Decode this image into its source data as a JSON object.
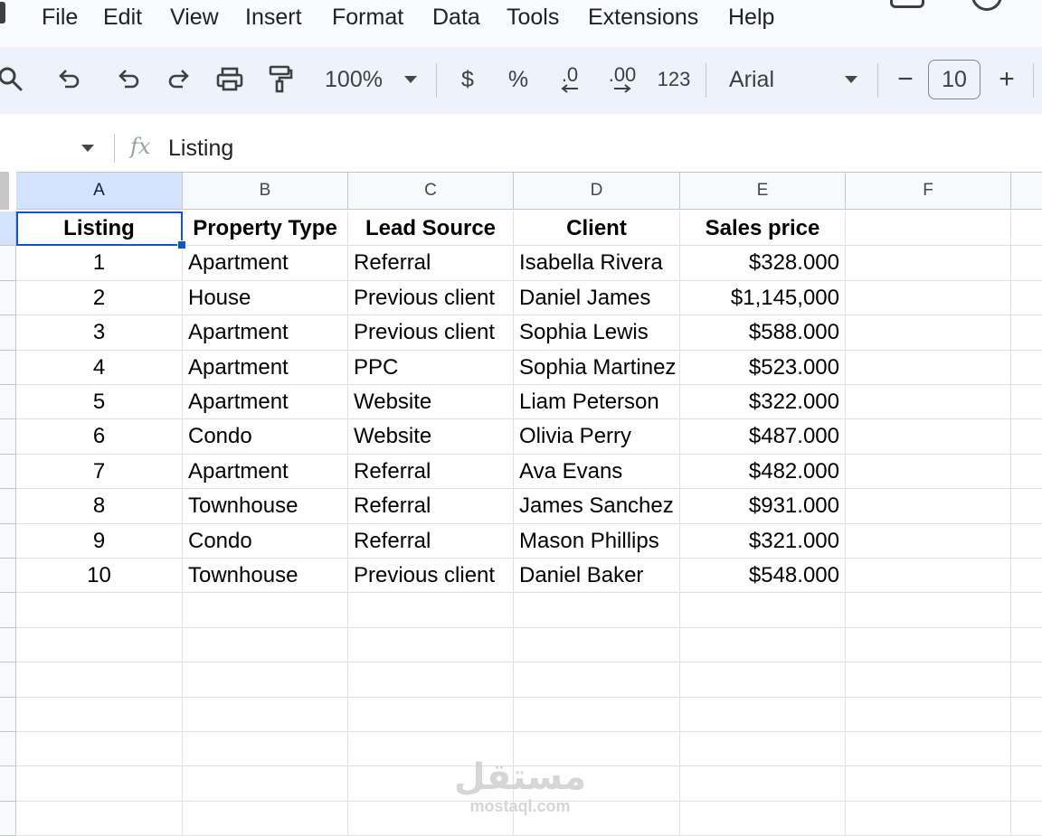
{
  "menu": {
    "items": [
      "File",
      "Edit",
      "View",
      "Insert",
      "Format",
      "Data",
      "Tools",
      "Extensions",
      "Help"
    ]
  },
  "toolbar": {
    "zoom": "100%",
    "currency_label": "$",
    "percent_label": "%",
    "decrease_decimals_label": ".0",
    "increase_decimals_label": ".00",
    "more_formats_label": "123",
    "font_name": "Arial",
    "font_size": "10",
    "decrease_font_label": "−",
    "increase_font_label": "+"
  },
  "formula_bar": {
    "fx_label": "fx",
    "content": "Listing"
  },
  "columns": [
    "A",
    "B",
    "C",
    "D",
    "E",
    "F"
  ],
  "table": {
    "headers": [
      "Listing",
      "Property Type",
      "Lead Source",
      "Client",
      "Sales price"
    ],
    "rows": [
      [
        "1",
        "Apartment",
        "Referral",
        "Isabella Rivera",
        "$328.000"
      ],
      [
        "2",
        "House",
        "Previous client",
        "Daniel James",
        "$1,145,000"
      ],
      [
        "3",
        "Apartment",
        "Previous client",
        "Sophia Lewis",
        "$588.000"
      ],
      [
        "4",
        "Apartment",
        "PPC",
        "Sophia Martinez",
        "$523.000"
      ],
      [
        "5",
        "Apartment",
        "Website",
        "Liam Peterson",
        "$322.000"
      ],
      [
        "6",
        "Condo",
        "Website",
        "Olivia Perry",
        "$487.000"
      ],
      [
        "7",
        "Apartment",
        "Referral",
        "Ava Evans",
        "$482.000"
      ],
      [
        "8",
        "Townhouse",
        "Referral",
        "James Sanchez",
        "$931.000"
      ],
      [
        "9",
        "Condo",
        "Referral",
        "Mason Phillips",
        "$321.000"
      ],
      [
        "10",
        "Townhouse",
        "Previous client",
        "Daniel Baker",
        "$548.000"
      ]
    ]
  },
  "watermark": {
    "arabic": "مستقل",
    "latin": "mostaql.com"
  },
  "colors": {
    "selection": "#0b57d0",
    "active_header": "#d3e3fd",
    "toolbar_bg": "#eef3fb"
  }
}
